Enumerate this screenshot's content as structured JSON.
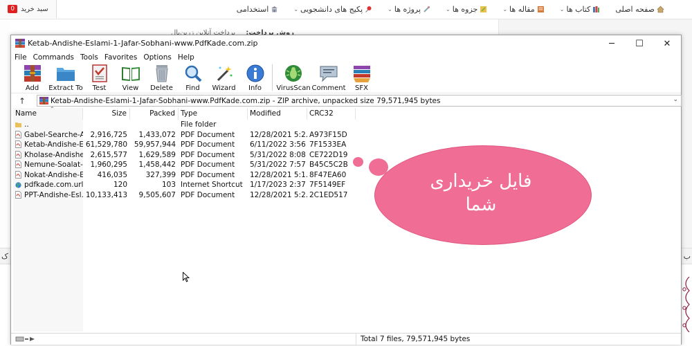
{
  "site": {
    "cart_label": "سبد خرید",
    "cart_count": "0",
    "nav": [
      {
        "label": "صفحه اصلی",
        "icon": "home-icon",
        "has_dropdown": false
      },
      {
        "label": "کتاب ها",
        "icon": "books-icon",
        "has_dropdown": true
      },
      {
        "label": "مقاله ها",
        "icon": "article-icon",
        "has_dropdown": true
      },
      {
        "label": "جزوه ها",
        "icon": "notebook-icon",
        "has_dropdown": true
      },
      {
        "label": "پروژه ها",
        "icon": "project-icon",
        "has_dropdown": true
      },
      {
        "label": "پکیج های دانشجویی",
        "icon": "pin-icon",
        "has_dropdown": true
      },
      {
        "label": "استخدامی",
        "icon": "building-icon",
        "has_dropdown": false
      }
    ],
    "behind_payment_label": "روش پرداخت:",
    "behind_payment_value": "پرداخت آنلاین زرین‌پال"
  },
  "winrar": {
    "title": "Ketab-Andishe-Eslami-1-Jafar-Sobhani-www.PdfKade.com.zip",
    "menu": [
      "File",
      "Commands",
      "Tools",
      "Favorites",
      "Options",
      "Help"
    ],
    "toolbar": [
      "Add",
      "Extract To",
      "Test",
      "View",
      "Delete",
      "Find",
      "Wizard",
      "Info",
      "VirusScan",
      "Comment",
      "SFX"
    ],
    "path": "Ketab-Andishe-Eslami-1-Jafar-Sobhani-www.PdfKade.com.zip - ZIP archive, unpacked size 79,571,945 bytes",
    "columns": [
      "Name",
      "Size",
      "Packed",
      "Type",
      "Modified",
      "CRC32"
    ],
    "files": [
      {
        "name": "..",
        "size": "",
        "packed": "",
        "type": "File folder",
        "modified": "",
        "crc": "",
        "icon": "folder-icon"
      },
      {
        "name": "Gabel-Searche-A...",
        "size": "2,916,725",
        "packed": "1,433,072",
        "type": "PDF Document",
        "modified": "12/28/2021 5:2...",
        "crc": "A973F15D",
        "icon": "pdf-icon"
      },
      {
        "name": "Ketab-Andishe-E...",
        "size": "61,529,780",
        "packed": "59,957,944",
        "type": "PDF Document",
        "modified": "6/11/2022 3:56 ...",
        "crc": "7F1533EA",
        "icon": "pdf-icon"
      },
      {
        "name": "Kholase-Andishe-...",
        "size": "2,615,577",
        "packed": "1,629,589",
        "type": "PDF Document",
        "modified": "5/31/2022 8:08 ...",
        "crc": "CE722D19",
        "icon": "pdf-icon"
      },
      {
        "name": "Nemune-Soalat-...",
        "size": "1,960,295",
        "packed": "1,458,442",
        "type": "PDF Document",
        "modified": "5/31/2022 7:57 ...",
        "crc": "B45C5C2B",
        "icon": "pdf-icon"
      },
      {
        "name": "Nokat-Andishe-E...",
        "size": "416,035",
        "packed": "327,399",
        "type": "PDF Document",
        "modified": "12/28/2021 5:1...",
        "crc": "8F47EA60",
        "icon": "pdf-icon"
      },
      {
        "name": "pdfkade.com.url",
        "size": "120",
        "packed": "103",
        "type": "Internet Shortcut",
        "modified": "1/17/2023 2:37 ...",
        "crc": "7F5149EF",
        "icon": "globe-icon"
      },
      {
        "name": "PPT-Andishe-Esl...",
        "size": "10,133,413",
        "packed": "9,505,607",
        "type": "PDF Document",
        "modified": "12/28/2021 5:2...",
        "crc": "2C1ED517",
        "icon": "pdf-icon"
      }
    ],
    "status_total": "Total 7 files, 79,571,945 bytes"
  },
  "annotation": {
    "text_line1": "فایل خریداری",
    "text_line2": "شما",
    "color": "#f06d95"
  }
}
